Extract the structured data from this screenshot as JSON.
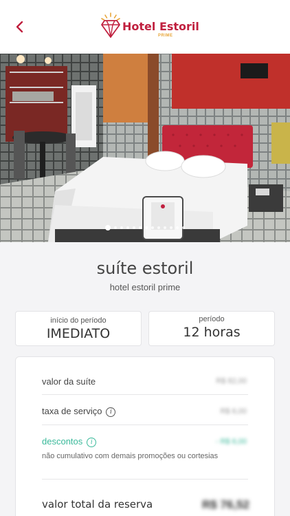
{
  "header": {
    "brand_name": "Hotel Estoril",
    "brand_sub": "PRIME",
    "back_icon": "chevron-left-icon",
    "accent_color": "#c0203f",
    "logo_sun_color": "#e7a53a"
  },
  "gallery": {
    "image_count": 13,
    "active_index": 0
  },
  "suite": {
    "name": "suíte estoril",
    "hotel": "hotel estoril prime"
  },
  "booking": {
    "start_label": "início do período",
    "start_value": "IMEDIATO",
    "period_label": "período",
    "period_value": "12 horas"
  },
  "pricing": {
    "suite_label": "valor da suíte",
    "suite_value": "R$ 82,00",
    "service_label": "taxa de serviço",
    "service_value": "R$ 6,00",
    "discount_label": "descontos",
    "discount_value": "- R$ 6,00",
    "discount_note": "não cumulativo com demais promoções ou cortesias",
    "total_label": "valor total da reserva",
    "total_value": "R$ 76,52",
    "discount_color": "#39b99a"
  }
}
